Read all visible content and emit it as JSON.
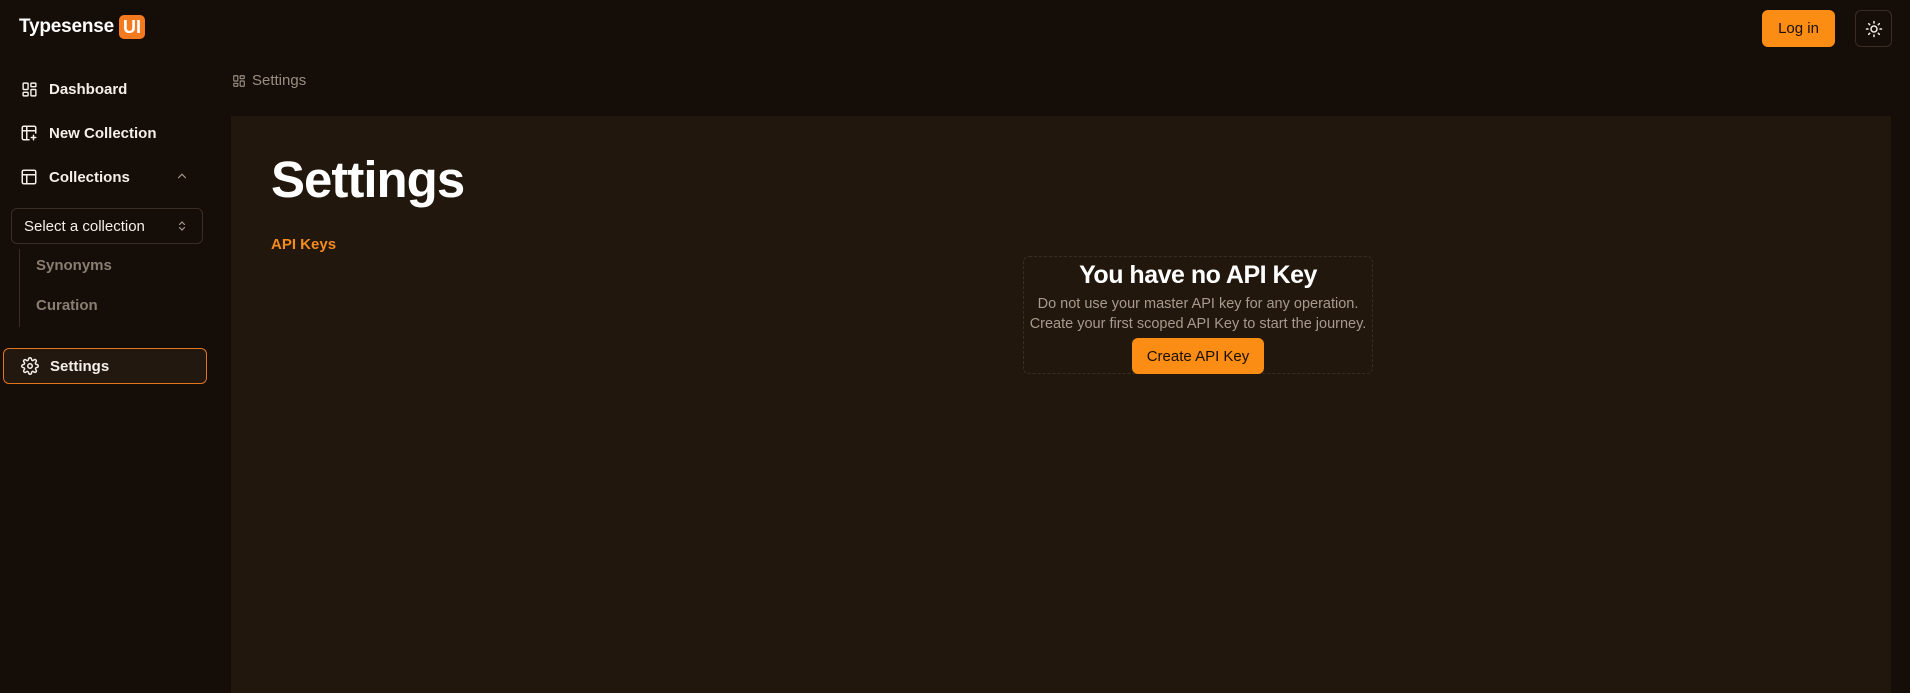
{
  "app": {
    "brand_name": "Typesense",
    "brand_badge": "UI"
  },
  "header": {
    "login_label": "Log in",
    "theme_toggle_icon": "sun-icon"
  },
  "sidebar": {
    "items": [
      {
        "label": "Dashboard",
        "icon": "dashboard-icon"
      },
      {
        "label": "New Collection",
        "icon": "table-plus-icon"
      },
      {
        "label": "Collections",
        "icon": "table-icon",
        "expanded": true
      }
    ],
    "collection_select": {
      "value": "Select a collection"
    },
    "sub_items": [
      {
        "label": "Synonyms"
      },
      {
        "label": "Curation"
      }
    ],
    "settings": {
      "label": "Settings",
      "icon": "gear-icon",
      "active": true
    }
  },
  "breadcrumb": {
    "label": "Settings",
    "icon": "dashboard-icon"
  },
  "main": {
    "title": "Settings",
    "tab_label": "API Keys",
    "empty_state": {
      "title": "You have no API Key",
      "line1": "Do not use your master API key for any operation.",
      "line2": "Create your first scoped API Key to start the journey.",
      "button_label": "Create API Key"
    }
  },
  "colors": {
    "accent": "#fb8c14",
    "background": "#140d08",
    "panel": "#21170d",
    "active_border": "#e2741c"
  }
}
